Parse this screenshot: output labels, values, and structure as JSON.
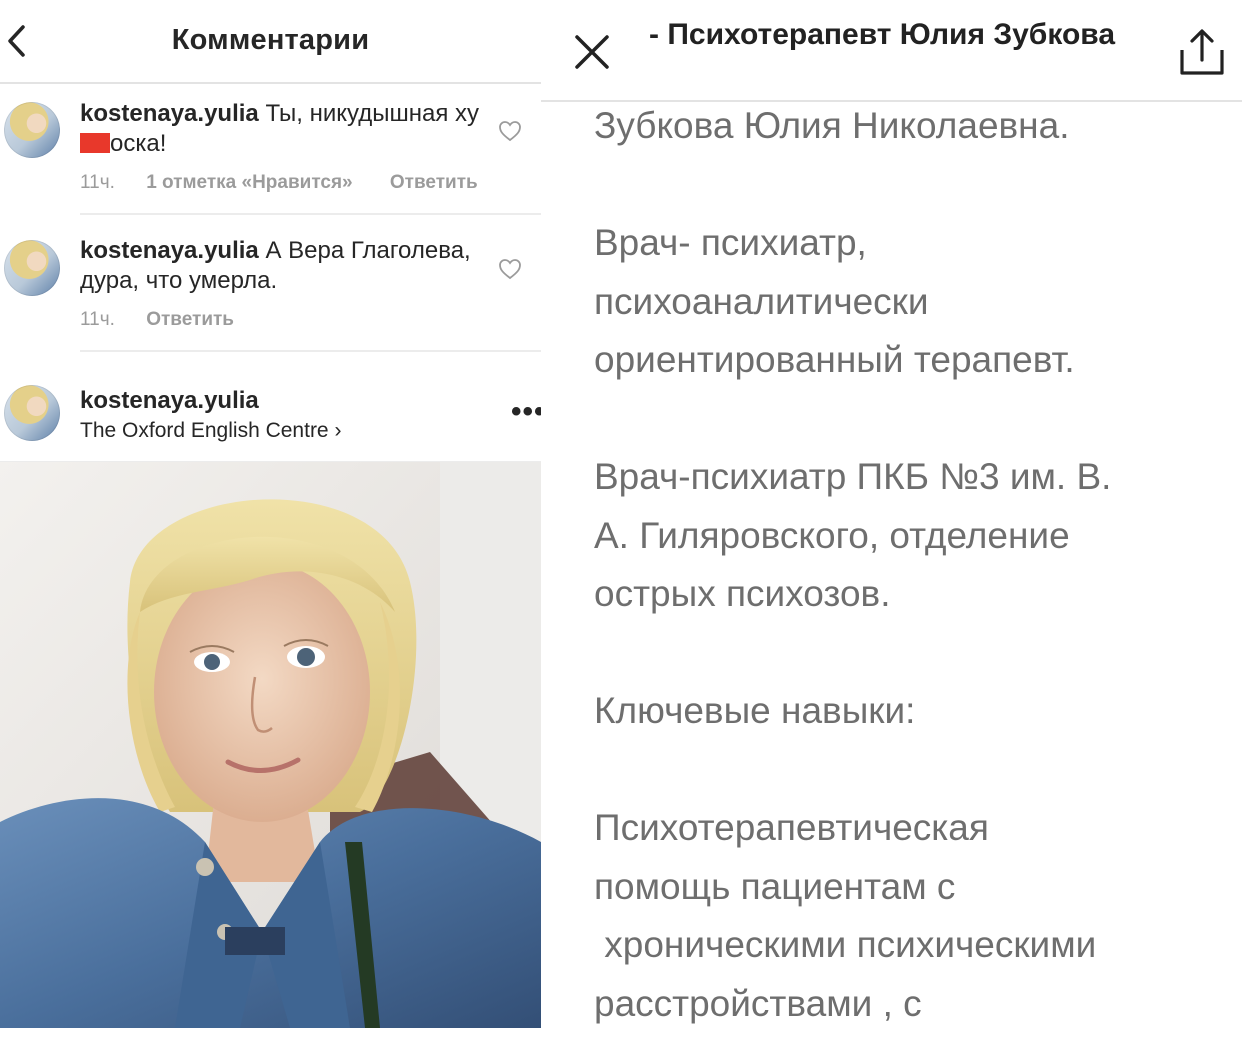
{
  "left_panel": {
    "header": {
      "title": "Комментарии"
    },
    "comments": [
      {
        "username": "kostenaya.yulia",
        "text_before": "Ты, никудышная ху",
        "text_after": "оска!",
        "time": "11ч.",
        "likes": "1 отметка «Нравится»",
        "reply": "Ответить"
      },
      {
        "username": "kostenaya.yulia",
        "text": "А Вера Глаголева, дура, что умерла.",
        "time": "11ч.",
        "reply": "Ответить"
      }
    ],
    "post": {
      "username": "kostenaya.yulia",
      "location": "The Oxford English Centre ›",
      "more": "•••"
    }
  },
  "right_panel": {
    "header": {
      "title": "- Психотерапевт Юлия Зубкова"
    },
    "body": {
      "name": "Зубкова Юлия Николаевна.",
      "role_1": "Врач- психиатр,",
      "role_2": "психоаналитически",
      "role_3": "ориентированный терапевт.",
      "work_1": "Врач-психиатр ПКБ №3 им. В.",
      "work_2": "А. Гиляровского, отделение",
      "work_3": "острых психозов.",
      "skills_heading": "Ключевые навыки:",
      "skills_1": "Психотерапевтическая",
      "skills_2": "помощь пациентам с",
      "skills_3": " хроническими психическими",
      "skills_4": "расстройствами , с"
    }
  },
  "colors": {
    "censor": "#e8382b",
    "muted": "#9b9b9b",
    "body_text": "#6e6e6e"
  }
}
